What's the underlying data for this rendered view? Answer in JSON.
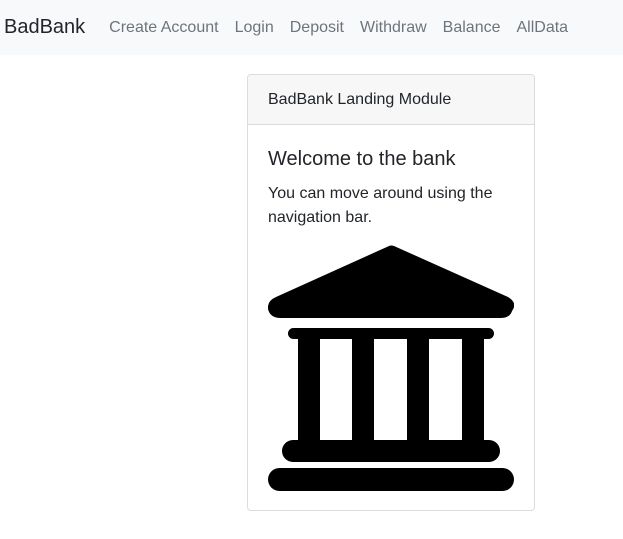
{
  "navbar": {
    "brand": "BadBank",
    "links": [
      "Create Account",
      "Login",
      "Deposit",
      "Withdraw",
      "Balance",
      "AllData"
    ]
  },
  "card": {
    "header": "BadBank Landing Module",
    "title": "Welcome to the bank",
    "text": "You can move around using the navigation bar.",
    "image_icon": "bank-building-icon"
  },
  "colors": {
    "navbar_bg": "#f8f9fa",
    "link": "#6c757d",
    "text": "#212529",
    "card_header_bg": "#f7f7f7",
    "card_border": "#dcdcdc"
  }
}
